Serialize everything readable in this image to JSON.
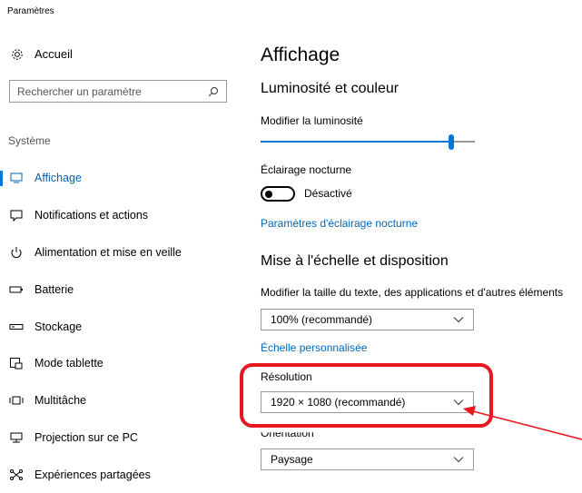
{
  "app": {
    "title": "Paramètres"
  },
  "sidebar": {
    "home_label": "Accueil",
    "search_placeholder": "Rechercher un paramètre",
    "section_label": "Système",
    "items": [
      {
        "label": "Affichage",
        "icon": "monitor-icon",
        "selected": true
      },
      {
        "label": "Notifications et actions",
        "icon": "notification-icon"
      },
      {
        "label": "Alimentation et mise en veille",
        "icon": "power-icon"
      },
      {
        "label": "Batterie",
        "icon": "battery-icon"
      },
      {
        "label": "Stockage",
        "icon": "storage-icon"
      },
      {
        "label": "Mode tablette",
        "icon": "tablet-mode-icon"
      },
      {
        "label": "Multitâche",
        "icon": "multitask-icon"
      },
      {
        "label": "Projection sur ce PC",
        "icon": "projection-icon"
      },
      {
        "label": "Expériences partagées",
        "icon": "shared-experiences-icon"
      }
    ]
  },
  "main": {
    "title": "Affichage",
    "brightness_section": "Luminosité et couleur",
    "brightness_label": "Modifier la luminosité",
    "brightness_value": 0.89,
    "night_light_label": "Éclairage nocturne",
    "night_light_state": "Désactivé",
    "night_light_link": "Paramètres d'éclairage nocturne",
    "scale_section": "Mise à l'échelle et disposition",
    "scale_label": "Modifier la taille du texte, des applications et d'autres éléments",
    "scale_value": "100% (recommandé)",
    "custom_scale_link": "Échelle personnalisée",
    "resolution_label": "Résolution",
    "resolution_value": "1920 × 1080 (recommandé)",
    "orientation_label": "Orientation",
    "orientation_value": "Paysage"
  },
  "colors": {
    "accent": "#0078d7",
    "link": "#0067b8",
    "annotation": "#e8161e"
  }
}
